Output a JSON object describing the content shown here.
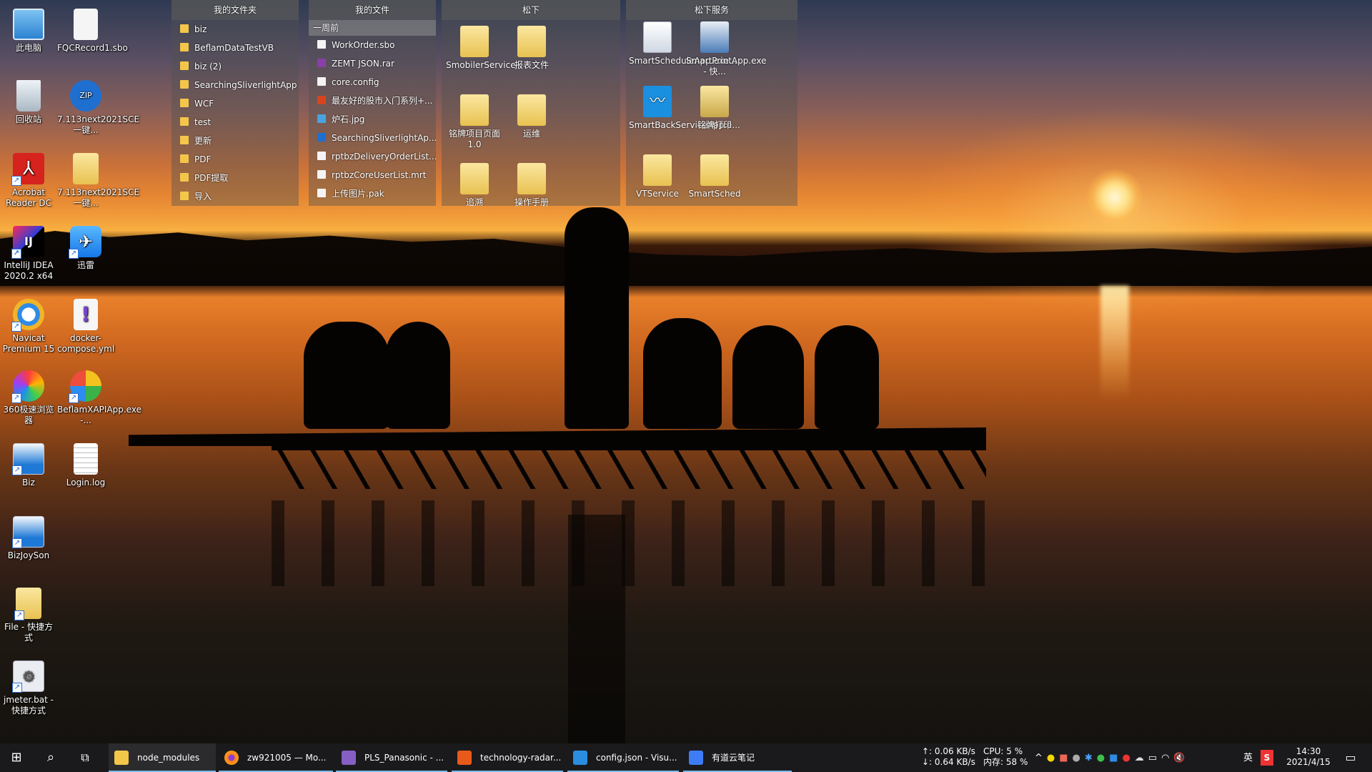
{
  "desktop_icons": [
    {
      "label": "此电脑",
      "icon": "computer-icon"
    },
    {
      "label": "FQCRecord1.sbo",
      "icon": "file-icon"
    },
    {
      "label": "回收站",
      "icon": "recycle-bin-icon"
    },
    {
      "label": "7.113next2021SCE一键...",
      "icon": "zip-icon"
    },
    {
      "label": "Acrobat Reader DC",
      "icon": "acrobat-icon"
    },
    {
      "label": "7.113next2021SCE一键...",
      "icon": "folder-icon"
    },
    {
      "label": "IntelliJ IDEA 2020.2 x64",
      "icon": "intellij-icon"
    },
    {
      "label": "迅雷",
      "icon": "xunlei-icon"
    },
    {
      "label": "Navicat Premium 15",
      "icon": "navicat-icon"
    },
    {
      "label": "docker-compose.yml",
      "icon": "yml-file-icon"
    },
    {
      "label": "360极速浏览器",
      "icon": "browser-360-icon"
    },
    {
      "label": "BeflamXAPIApp.exe -...",
      "icon": "app-icon"
    },
    {
      "label": "Biz",
      "icon": "app-shortcut-icon"
    },
    {
      "label": "Login.log",
      "icon": "log-file-icon"
    },
    {
      "label": "BizJoySon",
      "icon": "app-shortcut-icon"
    },
    {
      "label": "File - 快捷方式",
      "icon": "folder-shortcut-icon"
    },
    {
      "label": "jmeter.bat - 快捷方式",
      "icon": "bat-file-icon"
    }
  ],
  "fence1": {
    "title": "我的文件夹",
    "items": [
      "biz",
      "BeflamDataTestVB",
      "biz (2)",
      "SearchingSliverlightApp",
      "WCF",
      "test",
      "更新",
      "PDF",
      "PDF提取",
      "导入"
    ]
  },
  "fence2": {
    "title": "我的文件",
    "section": "一周前",
    "items": [
      "WorkOrder.sbo",
      "ZEMT JSON.rar",
      "core.config",
      "最友好的股市入门系列+...",
      "炉石.jpg",
      "SearchingSliverlightAp...",
      "rptbzDeliveryOrderList...",
      "rptbzCoreUserList.mrt",
      "上传图片.pak"
    ]
  },
  "fence3": {
    "title": "松下",
    "items": [
      "SmobilerService",
      "报表文件",
      "铭牌项目页面1.0",
      "运维",
      "追溯",
      "操作手册"
    ]
  },
  "fence4": {
    "title": "松下服务",
    "items": [
      "SmartScheduleApp.exe...",
      "SmartPrintApp.exe - 快...",
      "SmartBackServiceApp.e...",
      "铭牌打印",
      "VTService",
      "SmartSched"
    ]
  },
  "taskbar": {
    "apps": [
      "node_modules",
      "zw921005 — Mo...",
      "PLS_Panasonic - ...",
      "technology-radar...",
      "config.json - Visu...",
      "有道云笔记"
    ],
    "net_up": "↑: 0.06 KB/s",
    "net_down": "↓: 0.64 KB/s",
    "cpu": "CPU: 5 %",
    "mem": "内存: 58 %",
    "ime": "英",
    "time": "14:30",
    "date": "2021/4/15"
  }
}
